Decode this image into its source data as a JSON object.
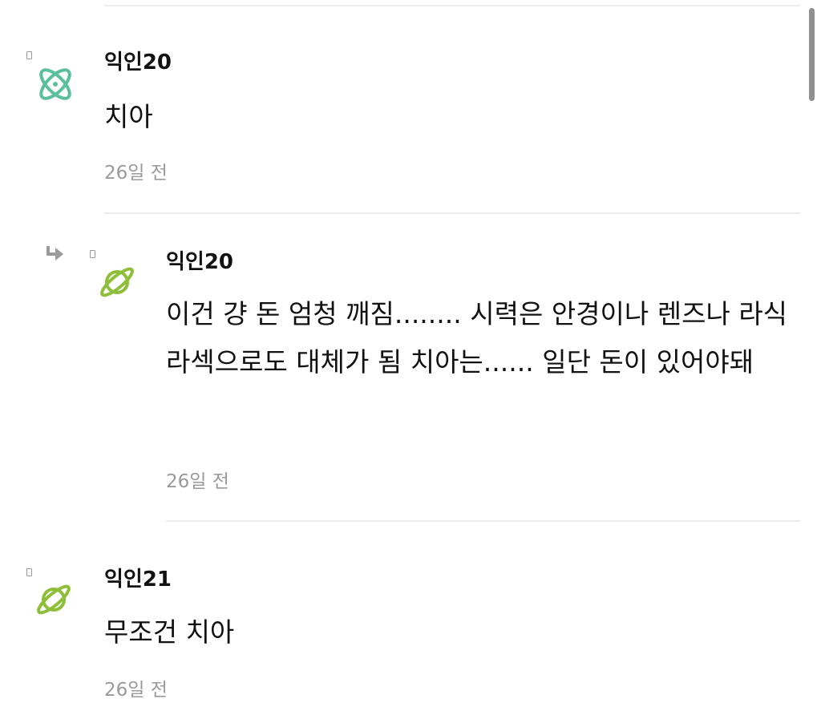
{
  "colors": {
    "accent_teal": "#5bbf9b",
    "accent_green": "#8fbf3a",
    "timestamp": "#9a9a9a",
    "divider": "#ececec",
    "text": "#111111"
  },
  "comments": [
    {
      "author": "익인20",
      "avatar_icon": "atom-icon",
      "is_reply": false,
      "text": "치아",
      "time": "26일 전"
    },
    {
      "author": "익인20",
      "avatar_icon": "planet-icon",
      "is_reply": true,
      "reply_icon": "reply-arrow-icon",
      "text": "이건 걍 돈 엄청 깨짐........ 시력은 안경이나 렌즈나 라식라섹으로도 대체가 됨 치아는...... 일단 돈이 있어야돼",
      "time": "26일 전"
    },
    {
      "author": "익인21",
      "avatar_icon": "planet-icon",
      "is_reply": false,
      "text": "무조건 치아",
      "time": "26일 전"
    }
  ]
}
